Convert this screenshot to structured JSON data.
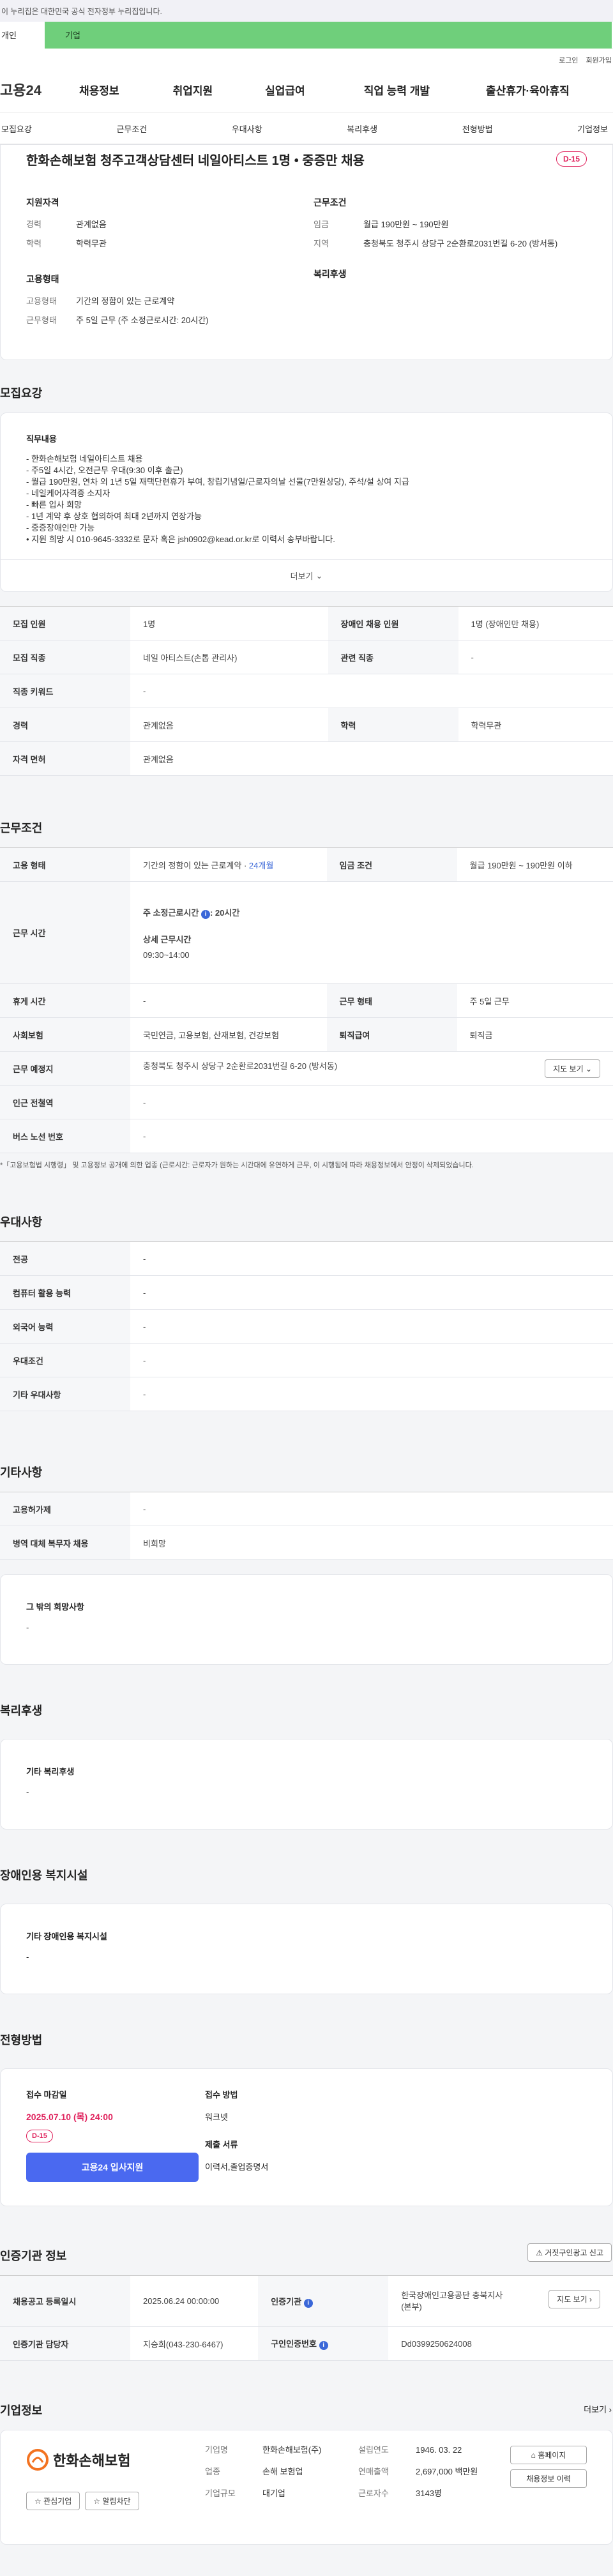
{
  "notice": "이 누리집은 대한민국 공식 전자정부 누리집입니다.",
  "tabs": {
    "individual": "개인",
    "business": "기업"
  },
  "util_links": [
    "로그인",
    "회원가입"
  ],
  "logo": "고용24",
  "gnb": [
    "채용정보",
    "취업지원",
    "실업급여",
    "직업 능력 개발",
    "출산휴가·육아휴직"
  ],
  "subnav": [
    "모집요강",
    "근무조건",
    "우대사항",
    "복리후생",
    "전형방법",
    "기업정보"
  ],
  "job": {
    "title": "한화손해보험 청주고객상담센터 네일아티스트 1명 • 중증만 채용",
    "dday": "D-15",
    "qual_title": "지원자격",
    "qual": [
      {
        "k": "경력",
        "v": "관계없음"
      },
      {
        "k": "학력",
        "v": "학력무관"
      }
    ],
    "cond_title": "근무조건",
    "cond": [
      {
        "k": "임금",
        "v": "월급 190만원 ~ 190만원"
      },
      {
        "k": "지역",
        "v": "충청북도 청주시 상당구 2순환로2031번길 6-20 (방서동)"
      }
    ],
    "emp_title": "고용형태",
    "emp": [
      {
        "k": "고용형태",
        "v": "기간의 정함이 있는 근로계약"
      },
      {
        "k": "근무형태",
        "v": "주 5일 근무 (주 소정근로시간: 20시간)"
      }
    ],
    "welfare_title": "복리후생"
  },
  "recruit": {
    "title": "모집요강",
    "duty_title": "직무내용",
    "duty_lines": [
      "- 한화손해보험 네일아티스트 채용",
      "- 주5일 4시간, 오전근무 우대(9:30 이후 출근)",
      "- 월급 190만원, 연차 외 1년 5일 재택단련휴가 부여, 창립기념일/근로자의날 선물(7만원상당), 주석/설 상여 지급",
      "- 네일케어자격증 소지자",
      "- 빠른 입사 희망",
      "- 1년 계약 후 상호 협의하여 최대 2년까지 연장가능",
      "- 중증장애인만 가능",
      "• 지원 희망 시 010-9645-3332로 문자 혹은 jsh0902@kead.or.kr로 이력서 송부바랍니다."
    ],
    "more": "더보기",
    "table": [
      [
        "모집 인원",
        "1명",
        "장애인 채용 인원",
        "1명 (장애인만 채용)"
      ],
      [
        "모집 직종",
        "네일 아티스트(손톱 관리사)",
        "관련 직종",
        "-"
      ],
      [
        "직종 키워드",
        "-",
        "",
        ""
      ],
      [
        "경력",
        "관계없음",
        "학력",
        "학력무관"
      ],
      [
        "자격 면허",
        "관계없음",
        "",
        ""
      ]
    ]
  },
  "work": {
    "title": "근무조건",
    "r1": [
      "고용 형태",
      "기간의 정함이 있는 근로계약",
      "24개월",
      "임금 조건",
      "월급 190만원 ~ 190만원 이하"
    ],
    "hours_label": "근무 시간",
    "hours_std": "주 소정근로시간",
    "hours_std_val": ": 20시간",
    "hours_detail_label": "상세 근무시간",
    "hours_detail": "09:30~14:00",
    "r3": [
      "휴게 시간",
      "-",
      "근무 형태",
      "주 5일 근무"
    ],
    "r4": [
      "사회보험",
      "국민연금, 고용보험, 산재보험, 건강보험",
      "퇴직급여",
      "퇴직금"
    ],
    "r5": [
      "근무 예정지",
      "충청북도 청주시 상당구 2순환로2031번길 6-20 (방서동)"
    ],
    "map_btn": "지도 보기",
    "r6": [
      "인근 전철역",
      "-"
    ],
    "r7": [
      "버스 노선 번호",
      "-"
    ],
    "note": "*「고용보험법 시행령」 및 고용정보 공개에 의한 업종 (근로시간: 근로자가 원하는 시간대에 유연하게 근무, 이 시행됨에 따라 채용정보에서 안정이 삭제되었습니다."
  },
  "pref": {
    "title": "우대사항",
    "rows": [
      [
        "전공",
        "-"
      ],
      [
        "컴퓨터 활용 능력",
        "-"
      ],
      [
        "외국어 능력",
        "-"
      ],
      [
        "우대조건",
        "-"
      ],
      [
        "기타 우대사항",
        "-"
      ]
    ]
  },
  "etc": {
    "title": "기타사항",
    "rows": [
      [
        "고용허가제",
        "-"
      ],
      [
        "병역 대체 복무자 채용",
        "비희망"
      ]
    ],
    "hope_title": "그 밖의 희망사항",
    "hope_val": "-"
  },
  "welfare": {
    "title": "복리후생",
    "sub": "기타 복리후생",
    "val": "-"
  },
  "disab": {
    "title": "장애인용 복지시설",
    "sub": "기타 장애인용 복지시설",
    "val": "-"
  },
  "process": {
    "title": "전형방법",
    "deadline_label": "접수 마감일",
    "deadline": "2025.07.10 (목) 24:00",
    "dday": "D-15",
    "apply_btn": "고용24 입사지원",
    "method_label": "접수 방법",
    "method": "워크넷",
    "docs_label": "제출 서류",
    "docs": "이력서,졸업증명서"
  },
  "cert": {
    "title": "인증기관 정보",
    "report_btn": "거짓구인광고 신고",
    "rows": [
      [
        "채용공고 등록일시",
        "2025.06.24 00:00:00",
        "인증기관",
        "한국장애인고용공단 충북지사(본부)"
      ],
      [
        "인증기관 담당자",
        "지승희(043-230-6467)",
        "구인인증번호",
        "Dd0399250624008"
      ]
    ],
    "map_btn": "지도 보기"
  },
  "company": {
    "title": "기업정보",
    "more": "더보기",
    "logo": "한화손해보험",
    "fav_btn": "관심기업",
    "alarm_btn": "알림차단",
    "rows": [
      [
        "기업명",
        "한화손해보험(주)",
        "설립연도",
        "1946. 03. 22"
      ],
      [
        "업종",
        "손해 보험업",
        "연매출액",
        "2,697,000 백만원"
      ],
      [
        "기업규모",
        "대기업",
        "근로자수",
        "3143명"
      ]
    ],
    "home_btn": "홈페이지",
    "jobs_btn": "채용정보 이력"
  }
}
